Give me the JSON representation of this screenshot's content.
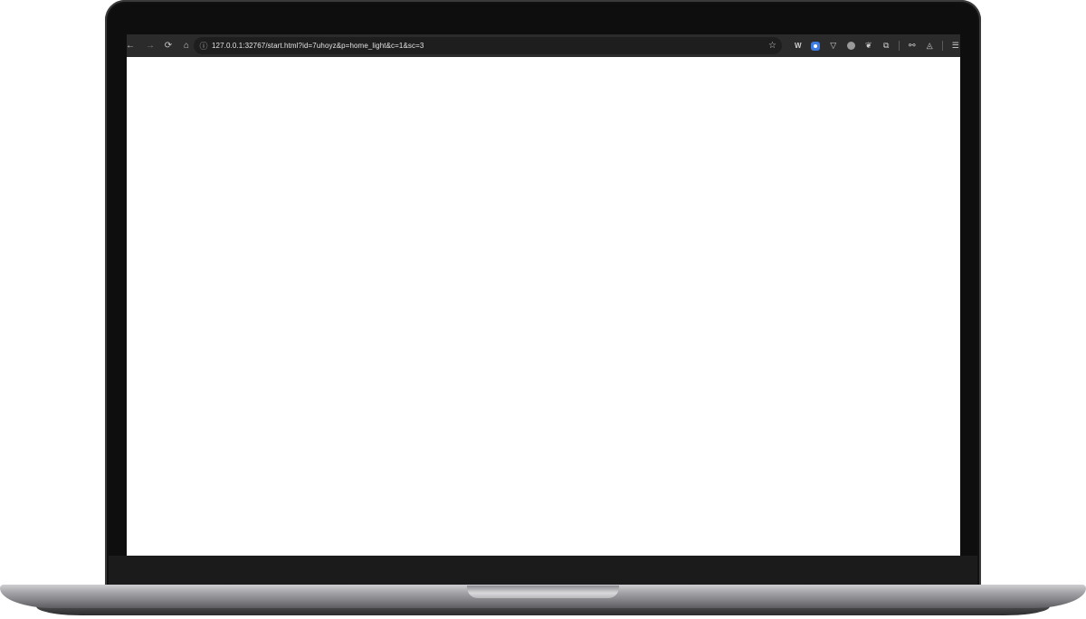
{
  "browser": {
    "nav": {
      "back_icon": "arrow-left-icon",
      "forward_icon": "arrow-right-icon",
      "reload_icon": "reload-icon",
      "home_icon": "home-icon"
    },
    "address_bar": {
      "url": "127.0.0.1:32767/start.html?id=7uhoyz&p=home_light&c=1&sc=3",
      "site_info_icon": "site-info-icon",
      "bookmark_icon": "star-icon"
    },
    "extensions": [
      {
        "icon": "extension-w-icon"
      },
      {
        "icon": "extension-blue-icon"
      },
      {
        "icon": "extension-v-icon"
      },
      {
        "icon": "extension-circle-icon"
      },
      {
        "icon": "extension-leaf-icon"
      },
      {
        "icon": "puzzle-icon"
      }
    ],
    "profile_icon": "profile-icon",
    "incognito_icon": "incognito-icon",
    "menu_icon": "menu-icon"
  },
  "page": {
    "content": ""
  }
}
